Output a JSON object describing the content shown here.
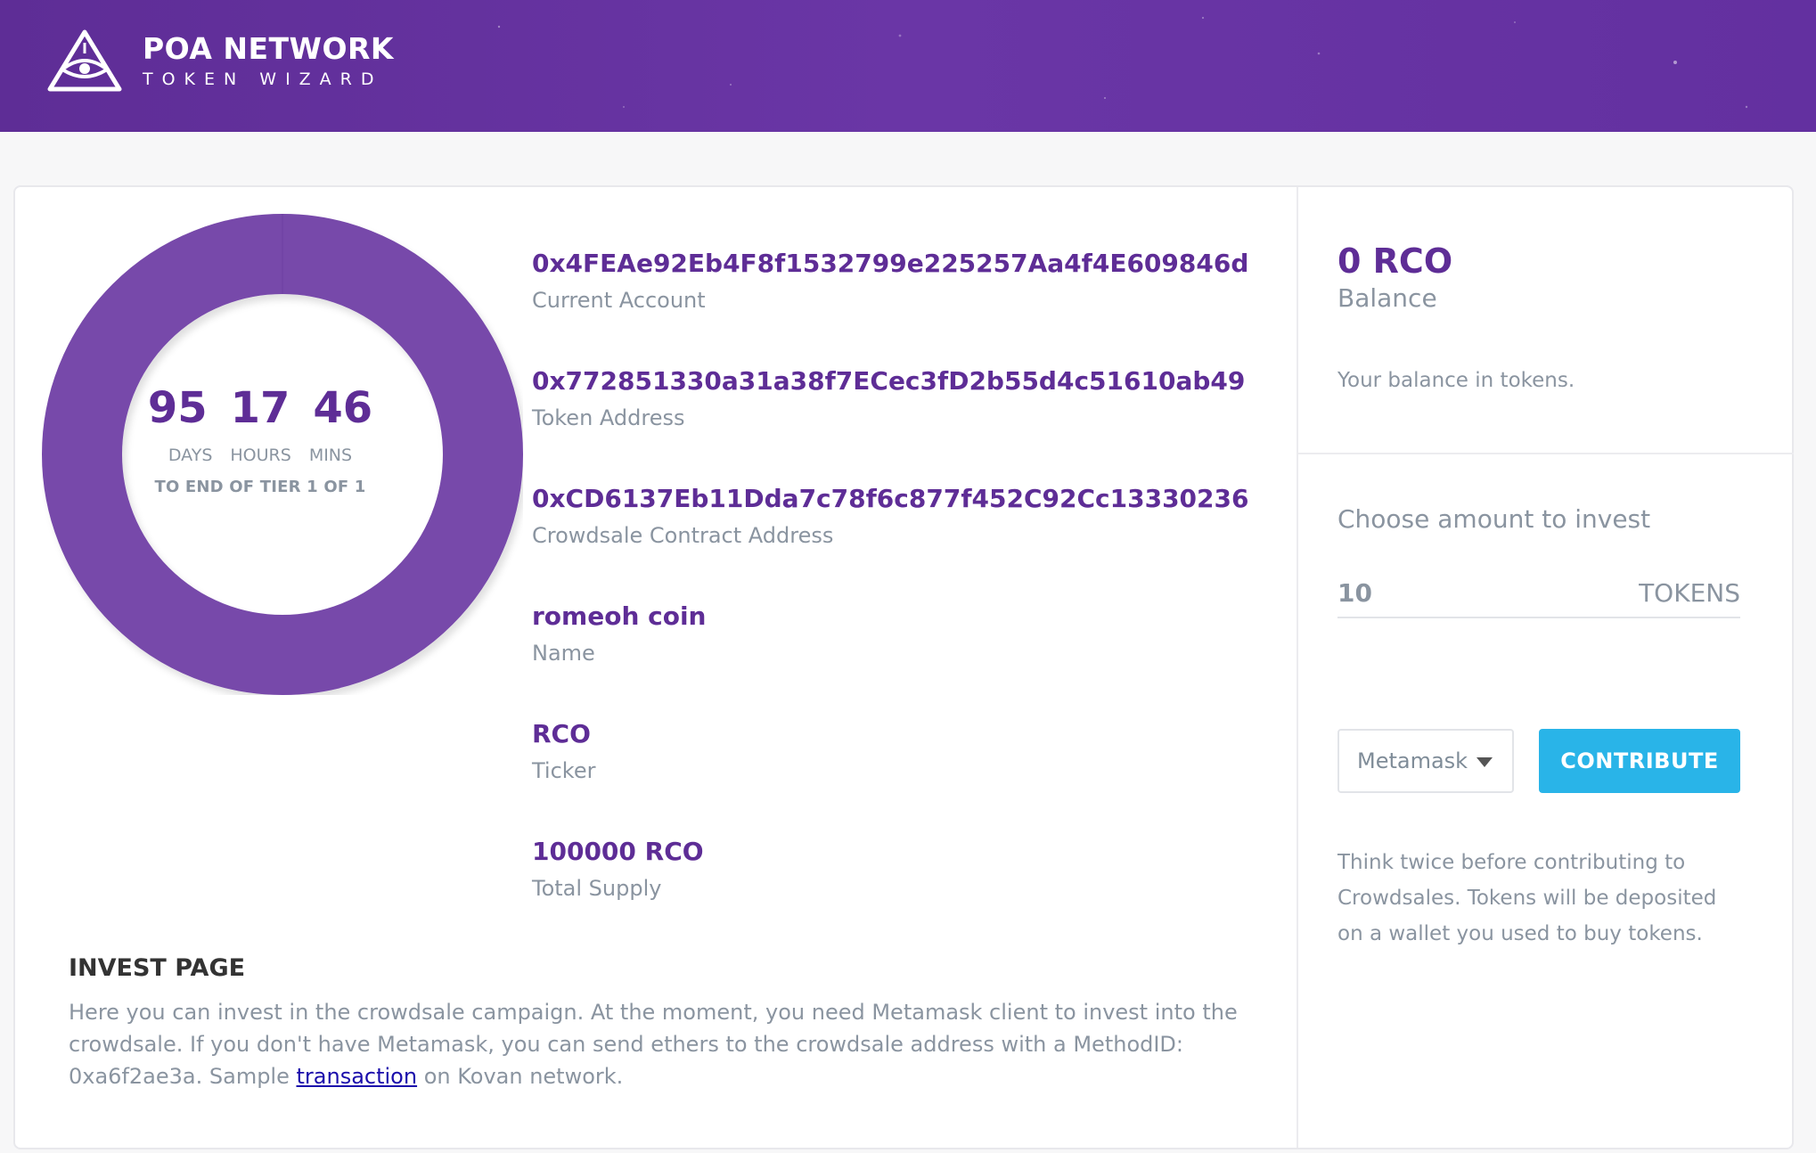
{
  "header": {
    "brand_title": "POA NETWORK",
    "brand_subtitle": "TOKEN WIZARD"
  },
  "timer": {
    "days": "95",
    "hours": "17",
    "mins": "46",
    "days_label": "DAYS",
    "hours_label": "HOURS",
    "mins_label": "MINS",
    "tier_text": "TO END OF TIER 1 OF 1"
  },
  "info": {
    "items": [
      {
        "value": "0x4FEAe92Eb4F8f1532799e225257Aa4f4E609846d",
        "label": "Current Account"
      },
      {
        "value": "0x772851330a31a38f7ECec3fD2b55d4c51610ab49",
        "label": "Token Address"
      },
      {
        "value": "0xCD6137Eb11Dda7c78f6c877f452C92Cc13330236",
        "label": "Crowdsale Contract Address"
      },
      {
        "value": "romeoh coin",
        "label": "Name"
      },
      {
        "value": "RCO",
        "label": "Ticker"
      },
      {
        "value": "100000 RCO",
        "label": "Total Supply"
      }
    ]
  },
  "invest": {
    "title": "INVEST PAGE",
    "desc_before": "Here you can invest in the crowdsale campaign. At the moment, you need Metamask client to invest into the crowdsale. If you don't have Metamask, you can send ethers to the crowdsale address with a MethodID: 0xa6f2ae3a. Sample ",
    "link_text": "transaction",
    "desc_after": " on Kovan network."
  },
  "balance": {
    "value": "0 RCO",
    "label": "Balance",
    "description": "Your balance in tokens."
  },
  "contribute": {
    "choose_label": "Choose amount to invest",
    "amount_value": "10",
    "amount_unit": "TOKENS",
    "wallet_selected": "Metamask",
    "button_label": "CONTRIBUTE",
    "warning": "Think twice before contributing to Crowdsales. Tokens will be deposited on a wallet you used to buy tokens."
  },
  "colors": {
    "brand_purple": "#5e2d96",
    "donut_purple": "#7748aa",
    "button_blue": "#29b4e8"
  },
  "icons": {
    "logo": "eye-triangle-icon",
    "dropdown": "caret-down-icon"
  },
  "progress": {
    "tier_elapsed_fraction": 0.0
  }
}
